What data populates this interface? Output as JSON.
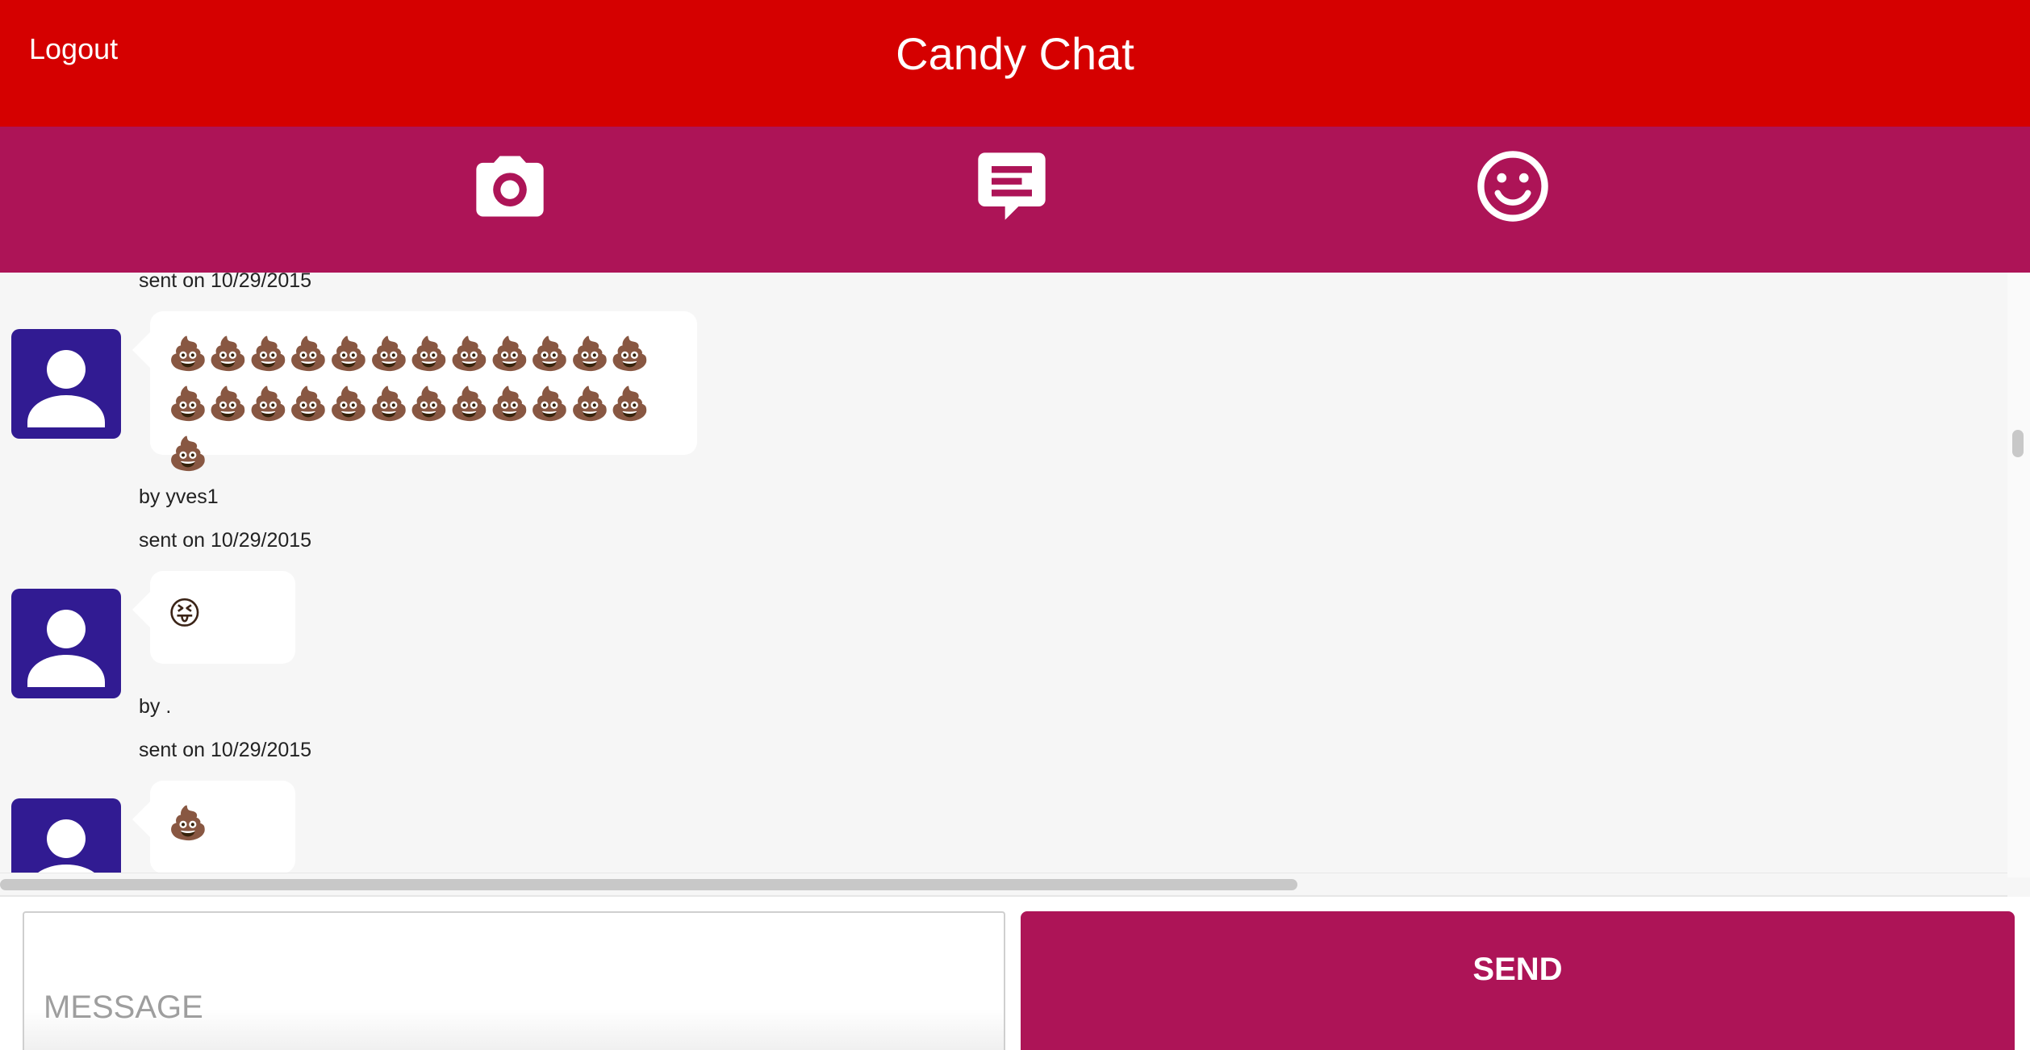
{
  "header": {
    "logout_label": "Logout",
    "title": "Candy Chat"
  },
  "tabs": [
    {
      "icon": "camera-icon"
    },
    {
      "icon": "chat-icon"
    },
    {
      "icon": "smiley-icon"
    }
  ],
  "messages": [
    {
      "sent": "sent on 10/29/2015",
      "text": "💩💩💩💩💩💩💩💩💩💩💩💩💩💩💩💩💩💩💩💩💩💩💩💩💩",
      "author": "by yves1"
    },
    {
      "sent": "sent on 10/29/2015",
      "text": "😝",
      "author": "by ."
    },
    {
      "sent": "sent on 10/29/2015",
      "text": "💩"
    }
  ],
  "composer": {
    "placeholder": "MESSAGE",
    "send_label": "SEND"
  },
  "colors": {
    "header": "#d50000",
    "tabbar": "#ad1457",
    "avatar": "#311b92",
    "send_button": "#ad1457"
  }
}
